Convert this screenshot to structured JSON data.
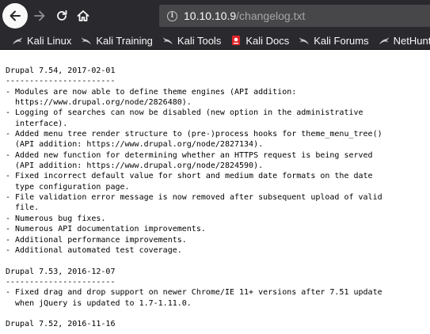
{
  "browser": {
    "url_host": "10.10.10.9",
    "url_path": "/changelog.txt",
    "icons": {
      "back": "back-arrow-icon",
      "forward": "forward-arrow-icon",
      "reload": "reload-icon",
      "home": "home-icon",
      "site_info": "info-icon"
    }
  },
  "bookmarks": [
    {
      "label": "Kali Linux",
      "icon": "kali-dragon-icon"
    },
    {
      "label": "Kali Training",
      "icon": "kali-dragon-icon"
    },
    {
      "label": "Kali Tools",
      "icon": "kali-dragon-icon"
    },
    {
      "label": "Kali Docs",
      "icon": "kali-docs-icon"
    },
    {
      "label": "Kali Forums",
      "icon": "kali-dragon-icon"
    },
    {
      "label": "NetHunter",
      "icon": "kali-dragon-icon"
    }
  ],
  "page": {
    "text": "Drupal 7.54, 2017-02-01\n-----------------------\n- Modules are now able to define theme engines (API addition:\n  https://www.drupal.org/node/2826480).\n- Logging of searches can now be disabled (new option in the administrative\n  interface).\n- Added menu tree render structure to (pre-)process hooks for theme_menu_tree()\n  (API addition: https://www.drupal.org/node/2827134).\n- Added new function for determining whether an HTTPS request is being served\n  (API addition: https://www.drupal.org/node/2824590).\n- Fixed incorrect default value for short and medium date formats on the date\n  type configuration page.\n- File validation error message is now removed after subsequent upload of valid\n  file.\n- Numerous bug fixes.\n- Numerous API documentation improvements.\n- Additional performance improvements.\n- Additional automated test coverage.\n\nDrupal 7.53, 2016-12-07\n-----------------------\n- Fixed drag and drop support on newer Chrome/IE 11+ versions after 7.51 update\n  when jQuery is updated to 1.7-1.11.0.\n\nDrupal 7.52, 2016-11-16\n-----------------------"
  },
  "colors": {
    "chrome_bg": "#2a2a2e",
    "urlbar_bg": "#474749",
    "url_host": "#f9f9fa",
    "url_path": "#a6a6a8",
    "page_bg": "#ffffff",
    "text": "#000000",
    "docs_icon_red": "#e0242a"
  }
}
